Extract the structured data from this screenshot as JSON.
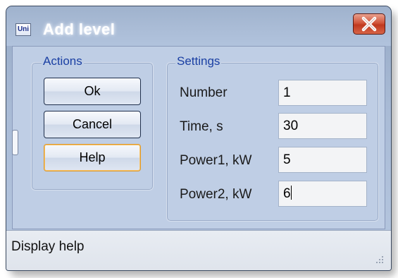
{
  "window": {
    "title": "Add level",
    "app_icon_text": "Uni"
  },
  "actions": {
    "group_label": "Actions",
    "ok_label": "Ok",
    "cancel_label": "Cancel",
    "help_label": "Help"
  },
  "settings": {
    "group_label": "Settings",
    "number_label": "Number",
    "number_value": "1",
    "time_label": "Time, s",
    "time_value": "30",
    "power1_label": "Power1, kW",
    "power1_value": "5",
    "power2_label": "Power2, kW",
    "power2_value": "6"
  },
  "statusbar": {
    "text": "Display help"
  },
  "colors": {
    "title_text": "#ffffff",
    "group_title": "#1a3fa3",
    "close_button": "#c0391f",
    "default_button_border": "#e09a2a"
  },
  "icons": [
    "app-icon",
    "close-icon",
    "resize-grip-icon"
  ]
}
